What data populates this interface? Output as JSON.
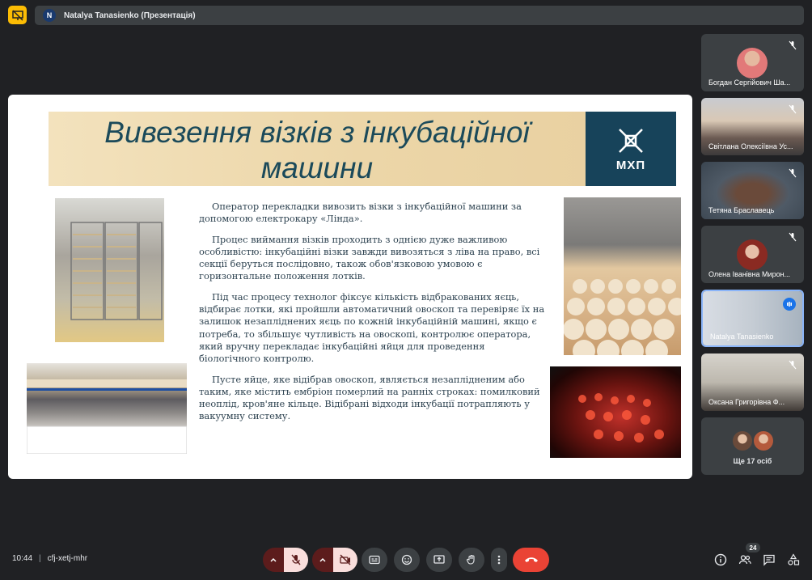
{
  "presenter": {
    "initial": "N",
    "title": "Natalya Tanasienko (Презентація)"
  },
  "slide": {
    "title": "Вивезення візків з інкубаційної машини",
    "logo_text": "МХП",
    "paragraphs": [
      "Оператор перекладки вивозить візки з інкубаційної машини за допомогою електрокару «Лінда».",
      "Процес виймання візків проходить з однією дуже важливою особливістю: інкубаційні візки завжди вивозяться з ліва на право, всі секції беруться послідовно, також обов'язковою умовою є горизонтальне положення лотків.",
      "Під час процесу технолог фіксує кількість відбракованих яєць, відбирає лотки, які пройшли автоматичний овоскоп та перевіряє їх на залишок незапліднених яєць по кожній інкубаційній машині, якщо є потреба, то збільшує чутливість на овоскопі, контролює оператора, який вручну перекладає інкубаційні яйця для проведення біологічного контролю.",
      "Пусте яйце, яке відібрав овоскоп,  являється незаплідненим або таким, яке містить ембріон померлий на ранніх строках: помилковий неоплід, кров'яне кільце. Відібрані відходи інкубації потрапляють у вакуумну систему."
    ]
  },
  "participants": [
    {
      "name": "Богдан Сергійович Ша...",
      "muted": true
    },
    {
      "name": "Світлана Олексіївна Ус...",
      "muted": true
    },
    {
      "name": "Тетяна Браславець",
      "muted": true
    },
    {
      "name": "Олена Іванівна Мирон...",
      "muted": true
    },
    {
      "name": "Natalya Tanasienko",
      "muted": false
    },
    {
      "name": "Оксана Григорівна Ф...",
      "muted": true
    }
  ],
  "more_participants": "Ще 17 осіб",
  "meeting": {
    "time": "10:44",
    "code": "cfj-xetj-mhr"
  },
  "people_count": "24",
  "colors": {
    "end_call": "#ea4335",
    "muted_ctrl": "#f9dedc",
    "accent": "#8ab4f8",
    "slide_title": "#1b4a5a"
  }
}
